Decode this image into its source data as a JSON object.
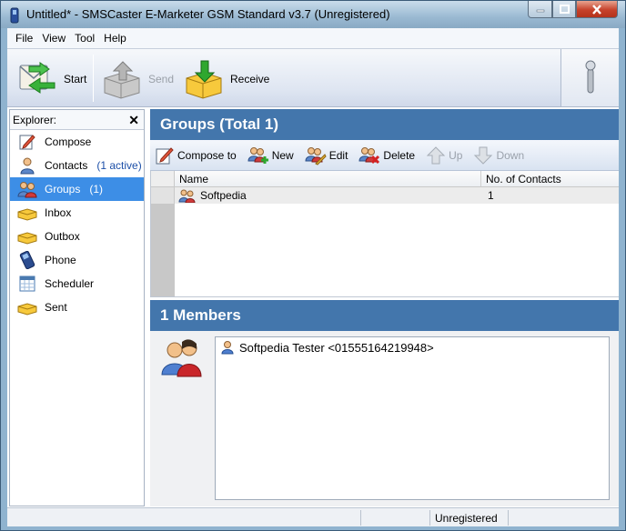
{
  "window": {
    "title": "Untitled* - SMSCaster E-Marketer GSM Standard v3.7 (Unregistered)"
  },
  "menu": [
    "File",
    "View",
    "Tool",
    "Help"
  ],
  "toolbar": {
    "start": "Start",
    "send": "Send",
    "receive": "Receive"
  },
  "explorer": {
    "title": "Explorer:",
    "items": [
      {
        "label": "Compose",
        "icon": "compose-icon"
      },
      {
        "label": "Contacts",
        "count": "(1 active)",
        "icon": "contacts-icon"
      },
      {
        "label": "Groups",
        "count": "(1)",
        "icon": "groups-icon",
        "selected": true
      },
      {
        "label": "Inbox",
        "icon": "inbox-icon"
      },
      {
        "label": "Outbox",
        "icon": "outbox-icon"
      },
      {
        "label": "Phone",
        "icon": "phone-icon"
      },
      {
        "label": "Scheduler",
        "icon": "scheduler-icon"
      },
      {
        "label": "Sent",
        "icon": "sent-icon"
      }
    ]
  },
  "groups": {
    "header": "Groups (Total 1)",
    "actions": {
      "compose": "Compose to",
      "new": "New",
      "edit": "Edit",
      "delete": "Delete",
      "up": "Up",
      "down": "Down"
    },
    "columns": {
      "name": "Name",
      "contacts": "No. of Contacts"
    },
    "rows": [
      {
        "name": "Softpedia",
        "contacts": "1"
      }
    ]
  },
  "members": {
    "header": "1 Members",
    "list": [
      "Softpedia Tester <01555164219948>"
    ]
  },
  "status": {
    "registration": "Unregistered"
  },
  "colors": {
    "header_blue": "#4376ac",
    "selection_blue": "#3d8ee6"
  }
}
